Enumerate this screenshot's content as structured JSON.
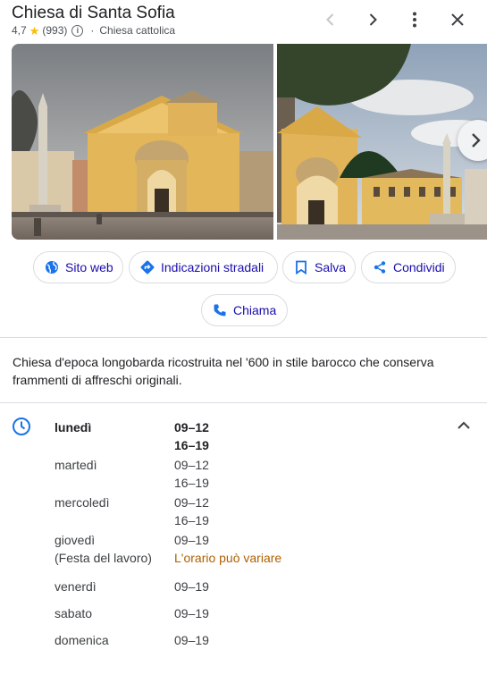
{
  "header": {
    "title": "Chiesa di Santa Sofia",
    "rating": "4,7",
    "reviews": "(993)",
    "separator": "·",
    "category": "Chiesa cattolica",
    "icons": [
      "chevron-left-icon",
      "chevron-right-icon",
      "more-vert-icon",
      "close-icon"
    ]
  },
  "actions": {
    "website": "Sito web",
    "directions": "Indicazioni stradali",
    "save": "Salva",
    "share": "Condividi",
    "call": "Chiama"
  },
  "description": "Chiesa d'epoca longobarda ricostruita nel '600 in stile barocco che conserva frammenti di affreschi originali.",
  "hours": {
    "days": [
      {
        "day": "lunedì",
        "times": [
          "09–12",
          "16–19"
        ],
        "current": true
      },
      {
        "day": "martedì",
        "times": [
          "09–12",
          "16–19"
        ]
      },
      {
        "day": "mercoledì",
        "times": [
          "09–12",
          "16–19"
        ]
      },
      {
        "day": "giovedì",
        "note": "(Festa del lavoro)",
        "times": [
          "09–19"
        ],
        "warning": "L'orario può variare"
      },
      {
        "day": "venerdì",
        "times": [
          "09–19"
        ]
      },
      {
        "day": "sabato",
        "times": [
          "09–19"
        ]
      },
      {
        "day": "domenica",
        "times": [
          "09–19"
        ]
      }
    ]
  },
  "colors": {
    "accent": "#1a73e8",
    "star": "#fbbc04",
    "warning": "#b06000"
  }
}
